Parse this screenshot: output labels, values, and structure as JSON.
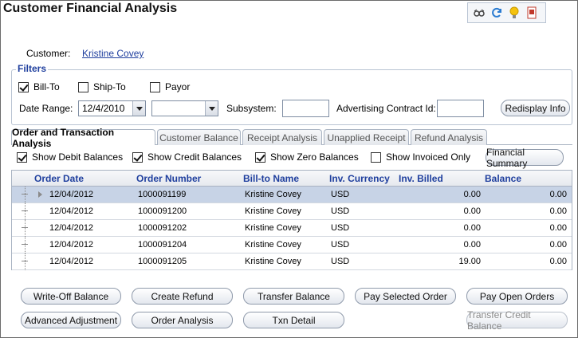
{
  "page": {
    "title": "Customer Financial Analysis"
  },
  "toolbar": {
    "icons": [
      "glasses-icon",
      "refresh-icon",
      "lightbulb-icon",
      "document-icon"
    ]
  },
  "customer": {
    "label": "Customer:",
    "name": "Kristine Covey"
  },
  "filters": {
    "legend": "Filters",
    "bill_to": {
      "label": "Bill-To",
      "checked": true
    },
    "ship_to": {
      "label": "Ship-To",
      "checked": false
    },
    "payor": {
      "label": "Payor",
      "checked": false
    },
    "date_range_label": "Date Range:",
    "date_from": "12/4/2010",
    "date_to": "",
    "subsystem_label": "Subsystem:",
    "subsystem_value": "",
    "ad_contract_label": "Advertising Contract Id:",
    "ad_contract_value": "",
    "redisplay_label": "Redisplay Info"
  },
  "tabs": [
    {
      "label": "Order and Transaction Analysis",
      "active": true
    },
    {
      "label": "Customer Balance",
      "active": false
    },
    {
      "label": "Receipt Analysis",
      "active": false
    },
    {
      "label": "Unapplied Receipt",
      "active": false
    },
    {
      "label": "Refund Analysis",
      "active": false
    }
  ],
  "options": {
    "show_debit": {
      "label": "Show Debit Balances",
      "checked": true
    },
    "show_credit": {
      "label": "Show Credit Balances",
      "checked": true
    },
    "show_zero": {
      "label": "Show Zero Balances",
      "checked": true
    },
    "show_invoiced": {
      "label": "Show Invoiced Only",
      "checked": false
    },
    "financial_summary_label": "Financial Summary"
  },
  "grid": {
    "columns": [
      "Order Date",
      "Order Number",
      "Bill-to Name",
      "Inv. Currency",
      "Inv. Billed",
      "Balance"
    ],
    "rows": [
      [
        "12/04/2012",
        "1000091199",
        "Kristine Covey",
        "USD",
        "0.00",
        "0.00"
      ],
      [
        "12/04/2012",
        "1000091200",
        "Kristine Covey",
        "USD",
        "0.00",
        "0.00"
      ],
      [
        "12/04/2012",
        "1000091202",
        "Kristine Covey",
        "USD",
        "0.00",
        "0.00"
      ],
      [
        "12/04/2012",
        "1000091204",
        "Kristine Covey",
        "USD",
        "0.00",
        "0.00"
      ],
      [
        "12/04/2012",
        "1000091205",
        "Kristine Covey",
        "USD",
        "19.00",
        "0.00"
      ]
    ],
    "selected_row": 0
  },
  "actions": {
    "write_off": "Write-Off Balance",
    "create_refund": "Create Refund",
    "transfer_balance": "Transfer Balance",
    "pay_selected": "Pay Selected Order",
    "pay_open": "Pay Open Orders",
    "advanced_adjustment": "Advanced Adjustment",
    "order_analysis": "Order Analysis",
    "txn_detail": "Txn Detail",
    "transfer_credit": "Transfer Credit Balance"
  }
}
